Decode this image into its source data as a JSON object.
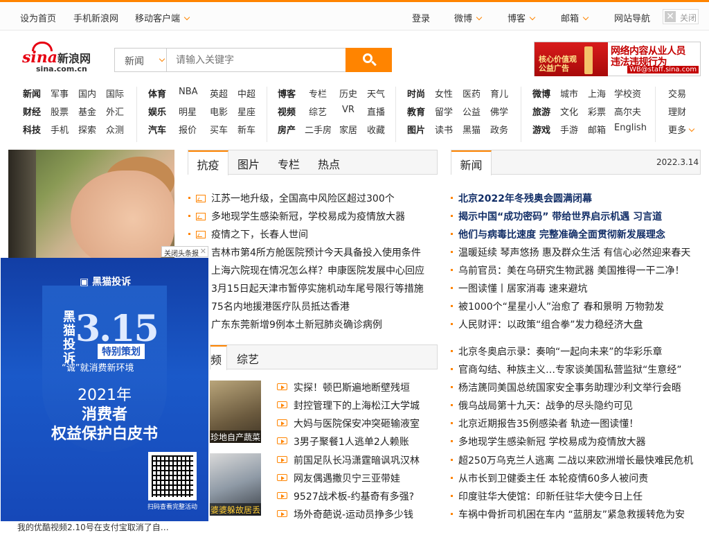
{
  "topbar": {
    "set_home": "设为首页",
    "mobile_sina": "手机新浪网",
    "mobile_client": "移动客户端",
    "login": "登录",
    "weibo": "微博",
    "blog": "博客",
    "mail": "邮箱",
    "site_nav": "网站导航",
    "close": "关闭"
  },
  "logo": {
    "brand": "sina",
    "brand_cn": "新浪网",
    "url": "sina.com.cn"
  },
  "search": {
    "category": "新闻",
    "placeholder": "请输入关键字"
  },
  "ad_banner": {
    "left_text": "核心价值观公益广告",
    "line1": "网络内容从业人员",
    "line2": "违法违规行为",
    "email": "WB@staff.sina.com"
  },
  "nav": {
    "col1_heads": [
      "新闻",
      "财经",
      "科技"
    ],
    "col1": [
      [
        "军事",
        "国内",
        "国际"
      ],
      [
        "股票",
        "基金",
        "外汇"
      ],
      [
        "手机",
        "探索",
        "众测"
      ]
    ],
    "col2_heads": [
      "体育",
      "娱乐",
      "汽车"
    ],
    "col2": [
      [
        "NBA",
        "英超",
        "中超"
      ],
      [
        "明星",
        "电影",
        "星座"
      ],
      [
        "报价",
        "买车",
        "新车"
      ]
    ],
    "col3_heads": [
      "博客",
      "视频",
      "房产"
    ],
    "col3": [
      [
        "专栏",
        "历史",
        "天气"
      ],
      [
        "综艺",
        "VR",
        "直播"
      ],
      [
        "二手房",
        "家居",
        "收藏"
      ]
    ],
    "col4_heads": [
      "时尚",
      "教育",
      "图片"
    ],
    "col4": [
      [
        "女性",
        "医药",
        "育儿"
      ],
      [
        "留学",
        "公益",
        "佛学"
      ],
      [
        "读书",
        "黑猫",
        "政务"
      ]
    ],
    "col5_heads": [
      "微博",
      "旅游",
      "游戏"
    ],
    "col5": [
      [
        "城市",
        "上海",
        "学校资"
      ],
      [
        "文化",
        "彩票",
        "高尔夫"
      ],
      [
        "手游",
        "邮箱",
        "English"
      ]
    ],
    "col6": [
      "交易",
      "理财",
      "更多"
    ]
  },
  "mid_tabs": [
    "抗疫",
    "图片",
    "专栏",
    "热点"
  ],
  "mid_news": [
    "江苏一地升级，全国高中风险区超过300个",
    "多地现学生感染新冠，学校易成为疫情放大器",
    "疫情之下，长春人世间",
    "吉林市第4所方舱医院预计今天具备投入使用条件",
    "上海六院现在情况怎么样？申康医院发展中心回应",
    "3月15日起天津市暂停实施机动车尾号限行等措施",
    "75名内地援港医疗队员抵达香港",
    "广东东莞新增9例本土新冠肺炎确诊病例"
  ],
  "video_tabs": [
    "频",
    "综艺"
  ],
  "video_thumbs": [
    "珍地自产蔬菜",
    "婆婆躲故居丢"
  ],
  "video_news": [
    "实探！顿巴斯遍地断壁残垣",
    "封控管理下的上海松江大学城",
    "大妈与医院保安冲突砸输液室",
    "3男子聚餐1人逃单2人赖账",
    "前国足队长冯潇霆暗讽巩汉林",
    "网友偶遇撒贝宁三亚带娃",
    "9527战术板-约基奇有多强?",
    "场外奇葩说-运动员挣多少钱"
  ],
  "right_tab": "新闻",
  "right_date": "2022.3.14",
  "right_bold_news": [
    "北京2022年冬残奥会圆满闭幕",
    "揭示中国“成功密码” 带给世界启示机遇 习言道",
    "他们与病毒比速度 完整准确全面贯彻新发展理念"
  ],
  "right_news": [
    "温暖延续 琴声悠扬 惠及群众生活 有信心必然迎来春天",
    "乌前官员：美在乌研究生物武器 美国推得一干二净！",
    "一图读懂丨居家消毒 速来避坑",
    "被1000个“星星小人”治愈了 春和景明 万物勃发",
    "人民财评：以政策“组合拳”发力稳经济大盘"
  ],
  "right_news2": [
    "北京冬奥启示录：奏响“一起向未来”的华彩乐章",
    "官商勾结、种族主义…专家谈美国私营监狱“生意经”",
    "杨洁篪同美国总统国家安全事务助理沙利文举行会晤",
    "俄乌战局第十九天：战争的尽头隐约可见",
    "北京近期报告35例感染者 轨迹一图读懂！",
    "多地现学生感染新冠 学校易成为疫情放大器",
    "超250万乌克兰人逃离 二战以来欧洲增长最快难民危机",
    "从市长到卫健委主任 本轮疫情60多人被问责",
    "印度驻华大使馆：印新任驻华大使今日上任",
    "车祸中骨折司机困在车内 “蓝朋友”紧急救援转危为安"
  ],
  "popup": {
    "close_label": "关闭头条报",
    "brand": "黑猫投诉",
    "big": "3.15",
    "vertical": "黑猫投诉",
    "special": "特别策划",
    "slogan": "“诚”就消费新环境",
    "year": "2021年",
    "line1": "消费者",
    "line2": "权益保护白皮书",
    "qr_caption": "扫码查看完整活动"
  },
  "bottom_text": "我的优酷视频2.10号在支付宝取消了自…"
}
